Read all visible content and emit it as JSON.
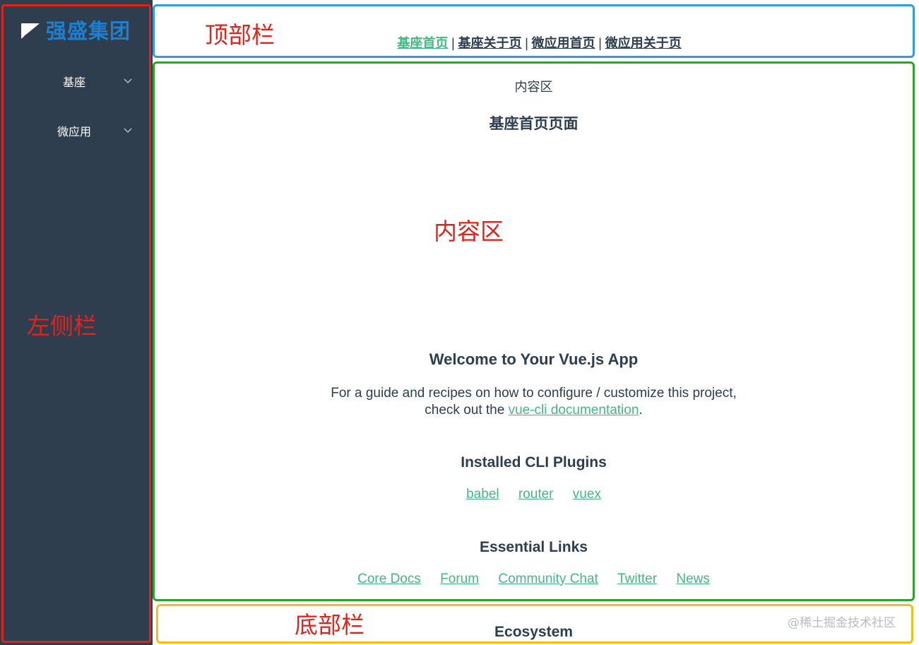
{
  "sidebar": {
    "logo_text": "强盛集团",
    "items": [
      {
        "label": "基座",
        "icon": "chevron-down-icon"
      },
      {
        "label": "微应用",
        "icon": "chevron-down-icon"
      }
    ]
  },
  "topbar": {
    "nav": [
      {
        "label": "基座首页",
        "active": true
      },
      {
        "label": "基座关于页",
        "active": false
      },
      {
        "label": "微应用首页",
        "active": false
      },
      {
        "label": "微应用关于页",
        "active": false
      }
    ],
    "separator": "|"
  },
  "annotations": {
    "top": "顶部栏",
    "sidebar": "左侧栏",
    "content": "内容区",
    "footer": "底部栏"
  },
  "content": {
    "label": "内容区",
    "page_heading": "基座首页页面",
    "welcome": "Welcome to Your Vue.js App",
    "intro_line1": "For a guide and recipes on how to configure / customize this project,",
    "intro_line2_prefix": "check out the ",
    "intro_link": "vue-cli documentation",
    "intro_line2_suffix": ".",
    "plugins_heading": "Installed CLI Plugins",
    "plugins": [
      "babel",
      "router",
      "vuex"
    ],
    "links_heading": "Essential Links",
    "links": [
      "Core Docs",
      "Forum",
      "Community Chat",
      "Twitter",
      "News"
    ],
    "ecosystem_heading": "Ecosystem"
  },
  "watermark": "@稀土掘金技术社区",
  "colors": {
    "sidebar_bg": "#2f3e4e",
    "logo": "#1d7fd0",
    "accent_green": "#42b983",
    "text": "#2c3e50",
    "annotation_red": "#e2231a",
    "frame_top": "#2f9bef",
    "frame_content": "#2aa52a",
    "frame_footer": "#f7be12",
    "frame_sidebar": "#e0231c"
  }
}
